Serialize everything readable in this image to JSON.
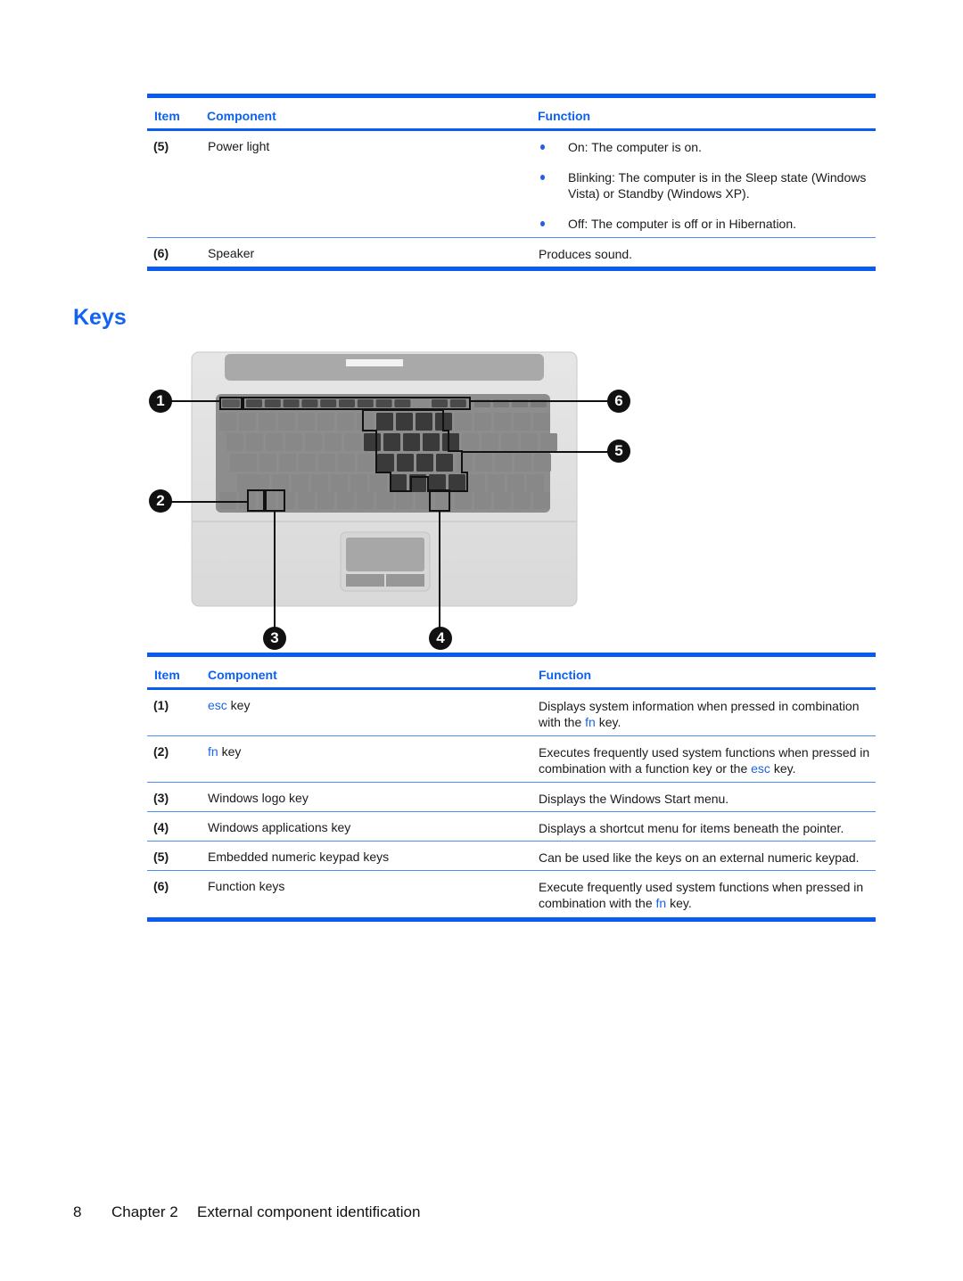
{
  "table1": {
    "headers": {
      "item": "Item",
      "component": "Component",
      "function": "Function"
    },
    "rows": [
      {
        "item": "(5)",
        "component": "Power light",
        "function_bullets": [
          "On: The computer is on.",
          "Blinking: The computer is in the Sleep state (Windows Vista) or Standby (Windows XP).",
          "Off: The computer is off or in Hibernation."
        ]
      },
      {
        "item": "(6)",
        "component": "Speaker",
        "function": "Produces sound."
      }
    ]
  },
  "section": {
    "title": "Keys"
  },
  "figure": {
    "description": "Laptop keyboard illustration with callouts",
    "callouts": [
      "1",
      "2",
      "3",
      "4",
      "5",
      "6"
    ]
  },
  "table2": {
    "headers": {
      "item": "Item",
      "component": "Component",
      "function": "Function"
    },
    "rows": [
      {
        "item": "(1)",
        "component_link": "esc",
        "component_rest": " key",
        "function_pre": "Displays system information when pressed in combination with the ",
        "function_link": "fn",
        "function_post": " key."
      },
      {
        "item": "(2)",
        "component_link": "fn",
        "component_rest": " key",
        "function_pre": "Executes frequently used system functions when pressed in combination with a function key or the ",
        "function_link": "esc",
        "function_post": " key."
      },
      {
        "item": "(3)",
        "component": "Windows logo key",
        "function": "Displays the Windows Start menu."
      },
      {
        "item": "(4)",
        "component": "Windows applications key",
        "function": "Displays a shortcut menu for items beneath the pointer."
      },
      {
        "item": "(5)",
        "component": "Embedded numeric keypad keys",
        "function": "Can be used like the keys on an external numeric keypad."
      },
      {
        "item": "(6)",
        "component": "Function keys",
        "function_pre": "Execute frequently used system functions when pressed in combination with the ",
        "function_link": "fn",
        "function_post": " key."
      }
    ]
  },
  "footer": {
    "page_number": "8",
    "chapter": "Chapter 2",
    "chapter_title": "External component identification"
  },
  "colors": {
    "accent": "#0f62f0",
    "link": "#1e63e6"
  }
}
